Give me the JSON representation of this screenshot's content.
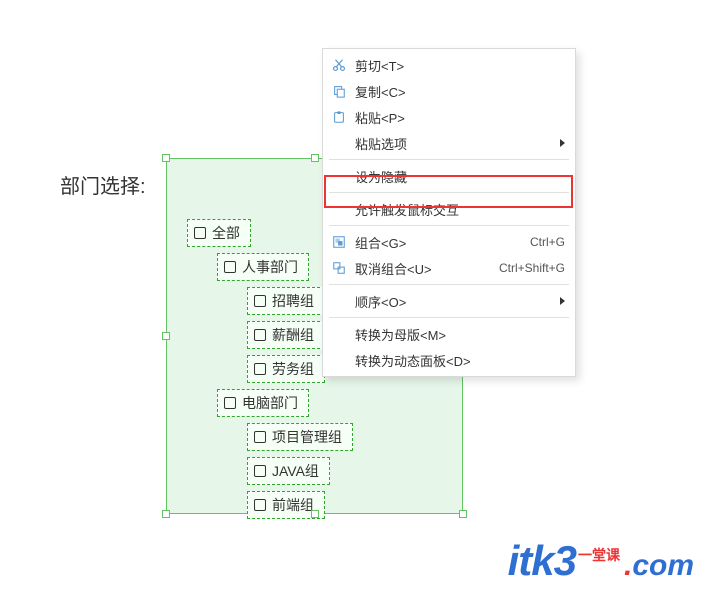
{
  "label": "部门选择:",
  "tree": {
    "items": [
      {
        "label": "全部",
        "level": 0
      },
      {
        "label": "人事部门",
        "level": 1
      },
      {
        "label": "招聘组",
        "level": 2,
        "clip": "招聘"
      },
      {
        "label": "薪酬组",
        "level": 2,
        "clip": "薪酬"
      },
      {
        "label": "劳务组",
        "level": 2,
        "clip": "劳务"
      },
      {
        "label": "电脑部门",
        "level": 1
      },
      {
        "label": "项目管理组",
        "level": 2
      },
      {
        "label": "JAVA组",
        "level": 2
      },
      {
        "label": "前端组",
        "level": 2
      }
    ]
  },
  "menu": {
    "items": [
      {
        "type": "item",
        "icon": "cut-icon",
        "label": "剪切<T>",
        "shortcut": ""
      },
      {
        "type": "item",
        "icon": "copy-icon",
        "label": "复制<C>",
        "shortcut": ""
      },
      {
        "type": "item",
        "icon": "paste-icon",
        "label": "粘贴<P>",
        "shortcut": ""
      },
      {
        "type": "item",
        "icon": "",
        "label": "粘贴选项",
        "submenu": true
      },
      {
        "type": "sep"
      },
      {
        "type": "item",
        "icon": "",
        "label": "设为隐藏",
        "highlight": true
      },
      {
        "type": "sep"
      },
      {
        "type": "item",
        "icon": "",
        "label": "允许触发鼠标交互"
      },
      {
        "type": "sep"
      },
      {
        "type": "item",
        "icon": "group-icon",
        "label": "组合<G>",
        "shortcut": "Ctrl+G"
      },
      {
        "type": "item",
        "icon": "ungroup-icon",
        "label": "取消组合<U>",
        "shortcut": "Ctrl+Shift+G"
      },
      {
        "type": "sep"
      },
      {
        "type": "item",
        "icon": "",
        "label": "顺序<O>",
        "submenu": true
      },
      {
        "type": "sep"
      },
      {
        "type": "item",
        "icon": "",
        "label": "转换为母版<M>"
      },
      {
        "type": "item",
        "icon": "",
        "label": "转换为动态面板<D>"
      }
    ]
  },
  "logo": {
    "main": "itk3",
    "tag": "一堂课",
    "dot": ".",
    "com": "com"
  }
}
